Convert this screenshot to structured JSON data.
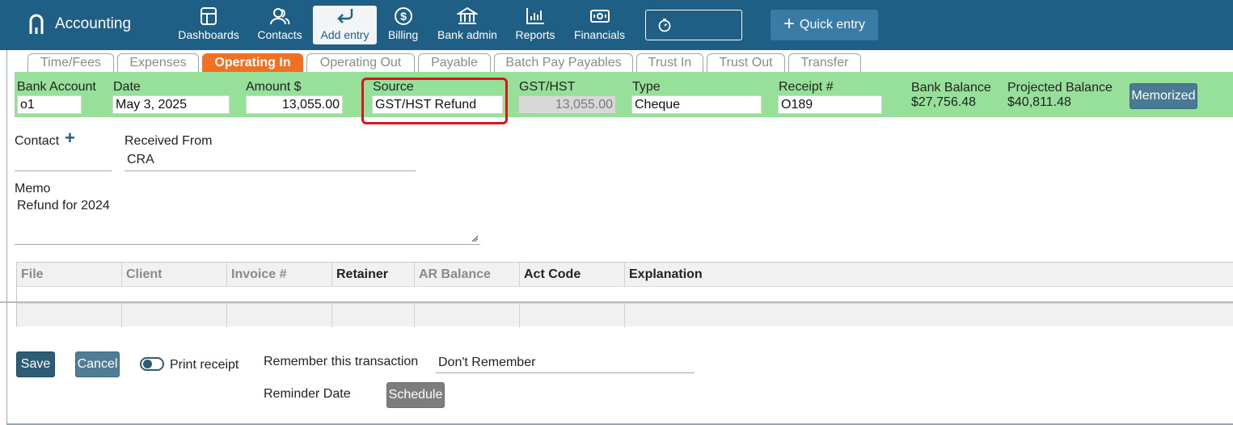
{
  "app": {
    "title": "Accounting"
  },
  "nav": [
    {
      "label": "Dashboards",
      "icon": "dashboard-icon"
    },
    {
      "label": "Contacts",
      "icon": "contacts-icon"
    },
    {
      "label": "Add entry",
      "icon": "return-arrow-icon",
      "active": true
    },
    {
      "label": "Billing",
      "icon": "dollar-circle-icon"
    },
    {
      "label": "Bank admin",
      "icon": "bank-icon"
    },
    {
      "label": "Reports",
      "icon": "bar-chart-icon"
    },
    {
      "label": "Financials",
      "icon": "banknote-icon"
    }
  ],
  "timer": {
    "icon": "stopwatch-icon"
  },
  "quick_entry": {
    "label": "Quick entry"
  },
  "tabs": [
    {
      "label": "Time/Fees"
    },
    {
      "label": "Expenses"
    },
    {
      "label": "Operating In",
      "active": true
    },
    {
      "label": "Operating Out"
    },
    {
      "label": "Payable"
    },
    {
      "label": "Batch Pay Payables"
    },
    {
      "label": "Trust In"
    },
    {
      "label": "Trust Out"
    },
    {
      "label": "Transfer"
    }
  ],
  "entry": {
    "bank_account": {
      "label": "Bank Account",
      "value": "o1"
    },
    "date": {
      "label": "Date",
      "value": "May 3, 2025"
    },
    "amount": {
      "label": "Amount $",
      "value": "13,055.00"
    },
    "source": {
      "label": "Source",
      "value": "GST/HST Refund"
    },
    "gst": {
      "label": "GST/HST",
      "value": "13,055.00"
    },
    "type": {
      "label": "Type",
      "value": "Cheque"
    },
    "receipt": {
      "label": "Receipt #",
      "value": "O189"
    },
    "bank_balance": {
      "label": "Bank Balance",
      "value": "$27,756.48"
    },
    "projected_balance": {
      "label": "Projected Balance",
      "value": "$40,811.48"
    },
    "memorized_label": "Memorized"
  },
  "contact": {
    "label": "Contact",
    "value": ""
  },
  "received_from": {
    "label": "Received From",
    "value": "CRA"
  },
  "memo": {
    "label": "Memo",
    "value": "Refund for 2024"
  },
  "table": {
    "columns": [
      "File",
      "Client",
      "Invoice #",
      "Retainer",
      "AR Balance",
      "Act Code",
      "Explanation"
    ]
  },
  "actions": {
    "save_label": "Save",
    "cancel_label": "Cancel",
    "print_receipt_label": "Print receipt",
    "print_receipt_checked": false,
    "remember_label": "Remember this transaction",
    "remember_value": "Don't Remember",
    "reminder_label": "Reminder Date",
    "schedule_label": "Schedule"
  },
  "colors": {
    "topbar": "#1f5f86",
    "active_tab": "#f36f21",
    "entry_strip": "#96e09a",
    "highlight": "#d9161d"
  }
}
